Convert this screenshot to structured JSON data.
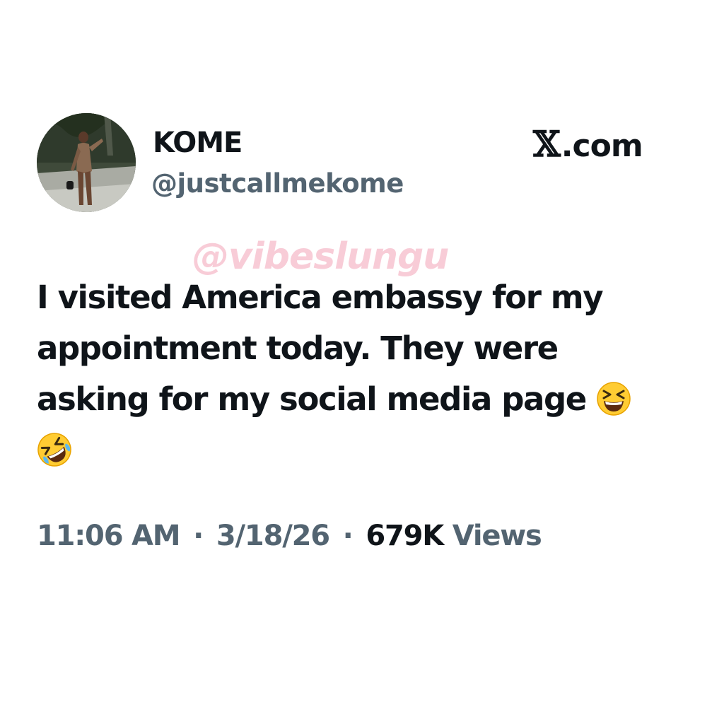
{
  "author": {
    "display_name": "KOME",
    "handle": "@justcallmekome"
  },
  "brand": {
    "x_mark": "𝕏",
    "suffix": ".com"
  },
  "watermark": "@vibeslungu",
  "tweet": {
    "lines": [
      "I visited America embassy for my",
      "appointment today. They were",
      "asking for my social media page"
    ],
    "emojis": [
      "grinning-squinting-face",
      "rolling-on-floor-laughing"
    ]
  },
  "meta": {
    "time": "11:06 AM",
    "date": "3/18/26",
    "separator": "·",
    "views_count": "679K",
    "views_label": "Views"
  },
  "colors": {
    "text_primary": "#0f1419",
    "text_secondary": "#536471",
    "watermark": "#ec7896",
    "background": "#ffffff"
  }
}
